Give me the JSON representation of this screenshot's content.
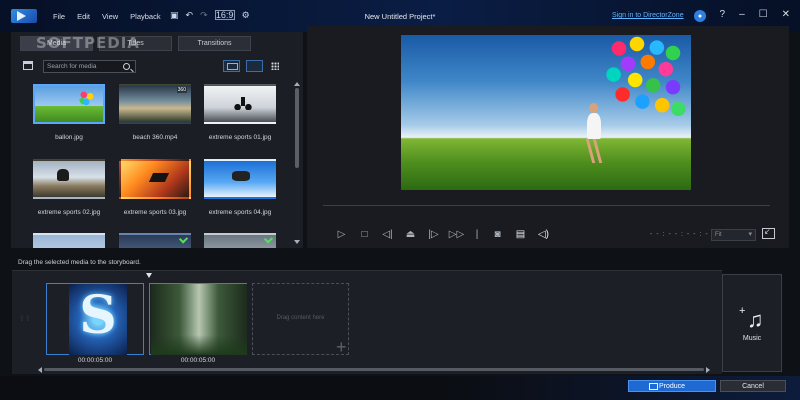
{
  "window": {
    "title": "New Untitled Project*",
    "signin_link": "Sign in to DirectorZone",
    "notification_icon": "bell-icon",
    "help_label": "?",
    "minimize_label": "–",
    "maximize_label": "☐",
    "close_label": "✕"
  },
  "watermark": "SOFTPEDIA",
  "menu": [
    "File",
    "Edit",
    "View",
    "Playback"
  ],
  "toolbar": {
    "save_icon": "💾",
    "undo_icon": "↶",
    "redo_icon": "↷",
    "aspect_label": "16:9",
    "settings_icon": "⚙"
  },
  "library": {
    "tabs": [
      "Media",
      "Titles",
      "Transitions"
    ],
    "search_placeholder": "Search for media",
    "items": [
      {
        "label": "ballon.jpg",
        "selected": true
      },
      {
        "label": "beach 360.mp4",
        "badge": "360"
      },
      {
        "label": "extreme sports 01.jpg"
      },
      {
        "label": "extreme sports 02.jpg"
      },
      {
        "label": "extreme sports 03.jpg"
      },
      {
        "label": "extreme sports 04.jpg"
      }
    ]
  },
  "preview": {
    "timecode": "- - : - - : - - : - -",
    "fit_label": "Fit",
    "controls": [
      "play-icon",
      "stop-icon",
      "previous-frame-icon",
      "split-icon",
      "next-frame-icon",
      "fast-forward-icon",
      "snapshot-icon",
      "subtitle-icon",
      "volume-icon"
    ]
  },
  "storyboard": {
    "hint": "Drag the selected media to the storyboard.",
    "clips": [
      {
        "duration": "00:00:05:00"
      },
      {
        "duration": "00:00:05:00"
      }
    ],
    "drop_placeholder": "Drag content here",
    "music_label": "Music"
  },
  "actions": {
    "produce_label": "Produce",
    "cancel_label": "Cancel"
  },
  "colors": {
    "accent": "#1f6ad2",
    "selection": "#5aa6ff",
    "link": "#5db4ff"
  }
}
